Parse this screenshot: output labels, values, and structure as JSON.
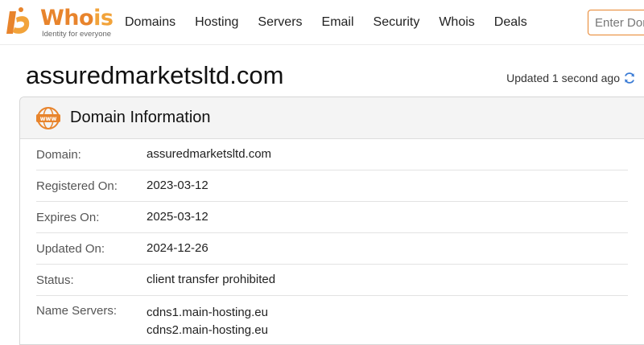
{
  "header": {
    "logo": {
      "word_a": "Who",
      "word_b": "is",
      "tagline": "Identity for everyone"
    },
    "nav": [
      "Domains",
      "Hosting",
      "Servers",
      "Email",
      "Security",
      "Whois",
      "Deals"
    ],
    "search": {
      "placeholder": "Enter Domain"
    },
    "colors": {
      "brand_orange": "#e8842c",
      "brand_light": "#f2a33a",
      "refresh_blue": "#3a7bd5"
    }
  },
  "page": {
    "title": "assuredmarketsltd.com",
    "updated": "Updated 1 second ago"
  },
  "card": {
    "title": "Domain Information",
    "icon": "www-icon",
    "rows": [
      {
        "label": "Domain:",
        "value": "assuredmarketsltd.com"
      },
      {
        "label": "Registered On:",
        "value": "2023-03-12"
      },
      {
        "label": "Expires On:",
        "value": "2025-03-12"
      },
      {
        "label": "Updated On:",
        "value": "2024-12-26"
      },
      {
        "label": "Status:",
        "value": "client transfer prohibited"
      },
      {
        "label": "Name Servers:",
        "values": [
          "cdns1.main-hosting.eu",
          "cdns2.main-hosting.eu"
        ]
      }
    ]
  }
}
